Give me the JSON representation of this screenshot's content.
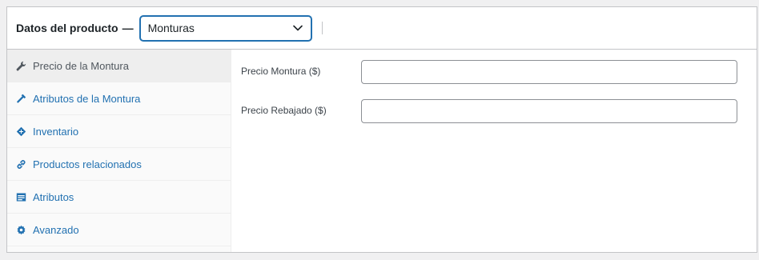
{
  "header": {
    "title": "Datos del producto",
    "separator": "—",
    "product_type": {
      "selected": "Monturas"
    }
  },
  "tabs": [
    {
      "label": "Precio de la Montura",
      "icon": "wrench-icon",
      "active": true
    },
    {
      "label": "Atributos de la Montura",
      "icon": "hammer-icon",
      "active": false
    },
    {
      "label": "Inventario",
      "icon": "tag-icon",
      "active": false
    },
    {
      "label": "Productos relacionados",
      "icon": "link-icon",
      "active": false
    },
    {
      "label": "Atributos",
      "icon": "list-view-icon",
      "active": false
    },
    {
      "label": "Avanzado",
      "icon": "gear-icon",
      "active": false
    }
  ],
  "fields": [
    {
      "label": "Precio Montura ($)",
      "value": "",
      "placeholder": ""
    },
    {
      "label": "Precio Rebajado ($)",
      "value": "",
      "placeholder": ""
    }
  ],
  "colors": {
    "link": "#2271b1",
    "active_tab_bg": "#eeeeee",
    "border": "#c3c4c7"
  }
}
